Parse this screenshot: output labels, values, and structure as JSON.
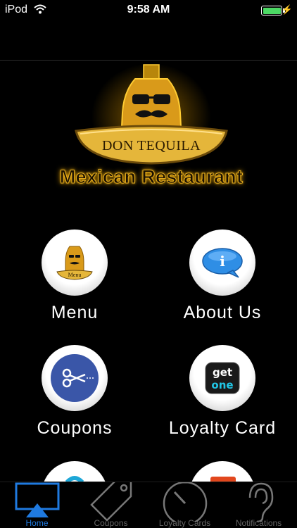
{
  "status_bar": {
    "carrier": "iPod",
    "time": "9:58 AM"
  },
  "logo": {
    "title": "DON TEQUILA",
    "subtitle": "Mexican Restaurant"
  },
  "grid": {
    "items": [
      {
        "label": "Menu",
        "icon": "menu-icon"
      },
      {
        "label": "About Us",
        "icon": "info-icon"
      },
      {
        "label": "Coupons",
        "icon": "scissors-icon"
      },
      {
        "label": "Loyalty Card",
        "icon": "get-one-icon"
      }
    ],
    "get_one_text": [
      "get",
      "one"
    ],
    "menu_icon_text": "Menu"
  },
  "tab_bar": {
    "active": "Home",
    "tabs": [
      {
        "label": "Home",
        "icon": "home-icon"
      },
      {
        "label": "Coupons",
        "icon": "tag-icon"
      },
      {
        "label": "Loyalty Cards",
        "icon": "gauge-icon"
      },
      {
        "label": "Notifications",
        "icon": "ear-icon"
      }
    ]
  },
  "colors": {
    "background": "#000000",
    "accent": "#1f7ae0",
    "battery": "#4cd964",
    "logo_gold": "#e0a81c"
  }
}
